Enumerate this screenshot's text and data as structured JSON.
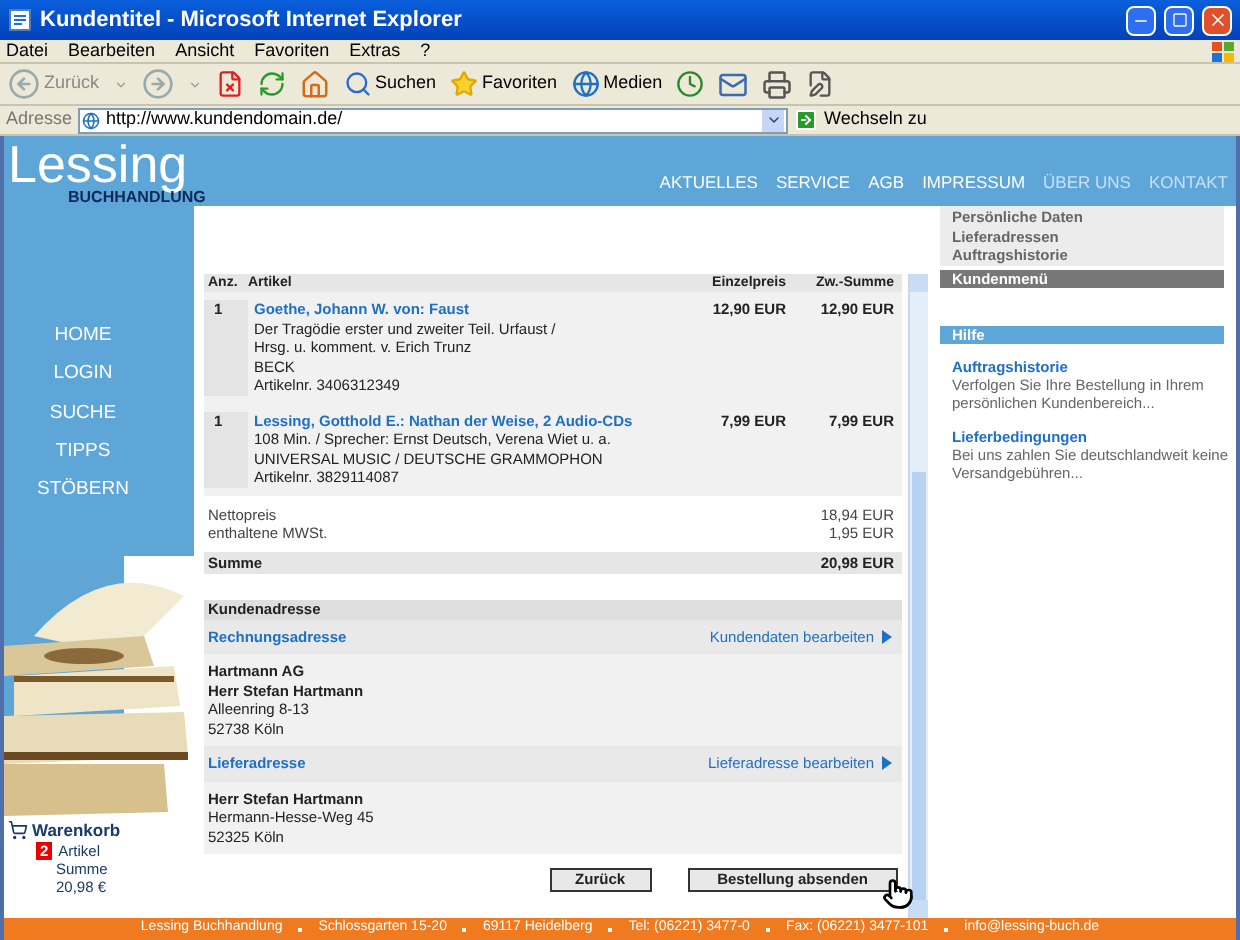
{
  "window": {
    "title": "Kundentitel - Microsoft Internet Explorer"
  },
  "menu": [
    "Datei",
    "Bearbeiten",
    "Ansicht",
    "Favoriten",
    "Extras",
    "?"
  ],
  "toolbar": {
    "back": "Zurück",
    "search": "Suchen",
    "favorites": "Favoriten",
    "media": "Medien"
  },
  "address_bar": {
    "label": "Adresse",
    "url": "http://www.kundendomain.de/",
    "go": "Wechseln zu"
  },
  "site": {
    "logo": {
      "name": "Lessing",
      "sub": "BUCHHANDLUNG"
    },
    "nav": [
      {
        "label": "AKTUELLES",
        "dimmed": false
      },
      {
        "label": "SERVICE",
        "dimmed": false
      },
      {
        "label": "AGB",
        "dimmed": false
      },
      {
        "label": "IMPRESSUM",
        "dimmed": false
      },
      {
        "label": "ÜBER UNS",
        "dimmed": true
      },
      {
        "label": "KONTAKT",
        "dimmed": true
      }
    ],
    "side_nav": [
      "HOME",
      "LOGIN",
      "SUCHE",
      "TIPPS",
      "STÖBERN"
    ],
    "cart": {
      "title": "Warenkorb",
      "count": "2",
      "count_label": "Artikel",
      "sum_label": "Summe",
      "sum": "20,98 €"
    },
    "order": {
      "columns": [
        "Anz.",
        "Artikel",
        "Einzelpreis",
        "Zw.-Summe"
      ],
      "items": [
        {
          "qty": "1",
          "title": "Goethe, Johann W. von: Faust",
          "details": [
            "Der Tragödie erster und zweiter Teil. Urfaust /",
            "Hrsg. u. komment. v. Erich Trunz",
            "BECK",
            "Artikelnr. 3406312349"
          ],
          "unit_price": "12,90 EUR",
          "subtotal": "12,90 EUR"
        },
        {
          "qty": "1",
          "title": "Lessing, Gotthold E.: Nathan der Weise, 2 Audio-CDs",
          "details": [
            "108 Min. / Sprecher: Ernst Deutsch, Verena Wiet u. a.",
            "UNIVERSAL MUSIC / DEUTSCHE GRAMMOPHON",
            "Artikelnr. 3829114087"
          ],
          "unit_price": "7,99 EUR",
          "subtotal": "7,99 EUR"
        }
      ],
      "totals": [
        {
          "label": "Nettopreis",
          "value": "18,94 EUR"
        },
        {
          "label": "enthaltene MWSt.",
          "value": "1,95 EUR"
        }
      ],
      "sum": {
        "label": "Summe",
        "value": "20,98 EUR"
      }
    },
    "addresses": {
      "title": "Kundenadresse",
      "blocks": [
        {
          "heading": "Rechnungsadresse",
          "edit_link": "Kundendaten bearbeiten",
          "lines": [
            {
              "text": "Hartmann AG",
              "bold": true
            },
            {
              "text": "Herr Stefan Hartmann",
              "bold": true
            },
            {
              "text": "Alleenring 8-13",
              "bold": false
            },
            {
              "text": "52738 Köln",
              "bold": false
            }
          ]
        },
        {
          "heading": "Lieferadresse",
          "edit_link": "Lieferadresse bearbeiten",
          "lines": [
            {
              "text": "Herr Stefan Hartmann",
              "bold": true
            },
            {
              "text": "Hermann-Hesse-Weg 45",
              "bold": false
            },
            {
              "text": "52325 Köln",
              "bold": false
            }
          ]
        }
      ]
    },
    "buttons": [
      "Zurück",
      "Bestellung absenden"
    ],
    "customer_menu": {
      "items": [
        "Persönliche Daten",
        "Lieferadressen",
        "Auftragshistorie"
      ],
      "title": "Kundenmenü"
    },
    "help": {
      "title": "Hilfe",
      "entries": [
        {
          "title": "Auftragshistorie",
          "text": "Verfolgen Sie Ihre Bestellung in Ihrem persönlichen Kundenbereich..."
        },
        {
          "title": "Lieferbedingungen",
          "text": "Bei uns zahlen Sie deutschlandweit keine Versandgebühren..."
        }
      ]
    },
    "footer": [
      "Lessing Buchhandlung",
      "Schlossgarten 15-20",
      "69117 Heidelberg",
      "Tel: (06221) 3477-0",
      "Fax: (06221) 3477-101",
      "info@lessing-buch.de"
    ]
  }
}
